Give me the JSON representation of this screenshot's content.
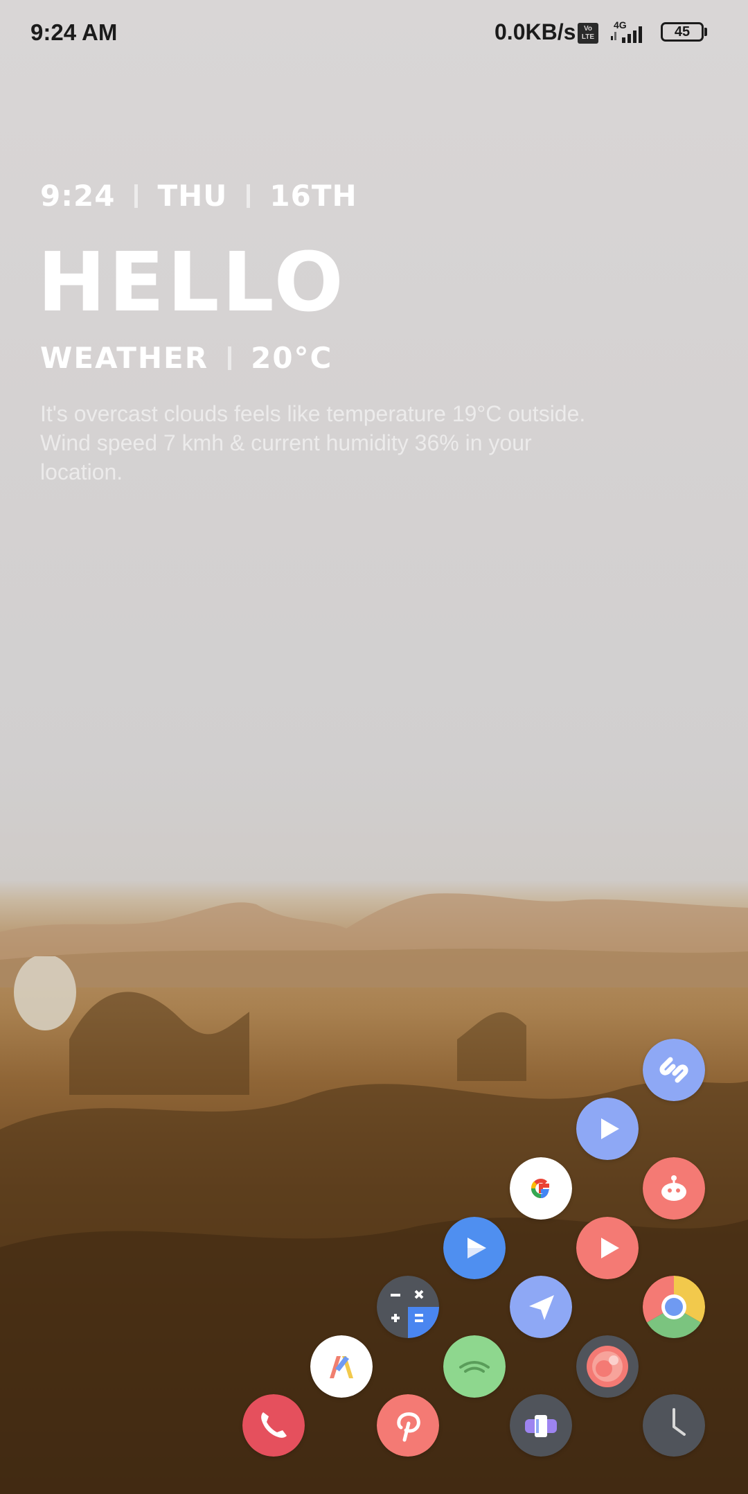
{
  "status_bar": {
    "time": "9:24 AM",
    "network_speed": "0.0KB/s",
    "volte_label_top": "Vo",
    "volte_label_bottom": "LTE",
    "network_type": "4G",
    "battery_level": "45"
  },
  "widget": {
    "time": "9:24",
    "day": "THU",
    "date": "16TH",
    "greeting": "HELLO",
    "weather_label": "WEATHER",
    "temperature": "20°C",
    "description": "It's overcast clouds feels like temperature 19°C outside. Wind speed 7 kmh & current humidity 36% in your location."
  },
  "apps": [
    {
      "name": "Shazam",
      "icon": "shazam-icon",
      "color": "#8ea8f5"
    },
    {
      "name": "Play",
      "icon": "play-icon",
      "color": "#8ea8f5"
    },
    {
      "name": "Google",
      "icon": "google-icon",
      "color": "#ffffff"
    },
    {
      "name": "Reddit",
      "icon": "reddit-icon",
      "color": "#f47a74"
    },
    {
      "name": "Play Store",
      "icon": "play-store-icon",
      "color": "#4f8ff0"
    },
    {
      "name": "YouTube",
      "icon": "youtube-icon",
      "color": "#f47a74"
    },
    {
      "name": "Calculator",
      "icon": "calculator-icon",
      "color": "#50545b"
    },
    {
      "name": "Navigation",
      "icon": "send-arrow-icon",
      "color": "#8ea8f5"
    },
    {
      "name": "Chrome",
      "icon": "chrome-icon",
      "color": "#ffffff"
    },
    {
      "name": "Launcher App",
      "icon": "letter-a-icon",
      "color": "#ffffff"
    },
    {
      "name": "WiFi",
      "icon": "wifi-icon",
      "color": "#8ed78e"
    },
    {
      "name": "Camera",
      "icon": "camera-lens-icon",
      "color": "#50545b"
    },
    {
      "name": "Phone",
      "icon": "phone-icon",
      "color": "#e5505d"
    },
    {
      "name": "Pinterest",
      "icon": "pinterest-icon",
      "color": "#f47a74"
    },
    {
      "name": "Gallery",
      "icon": "gallery-icon",
      "color": "#50545b"
    },
    {
      "name": "Clock",
      "icon": "clock-icon",
      "color": "#50545b"
    }
  ]
}
